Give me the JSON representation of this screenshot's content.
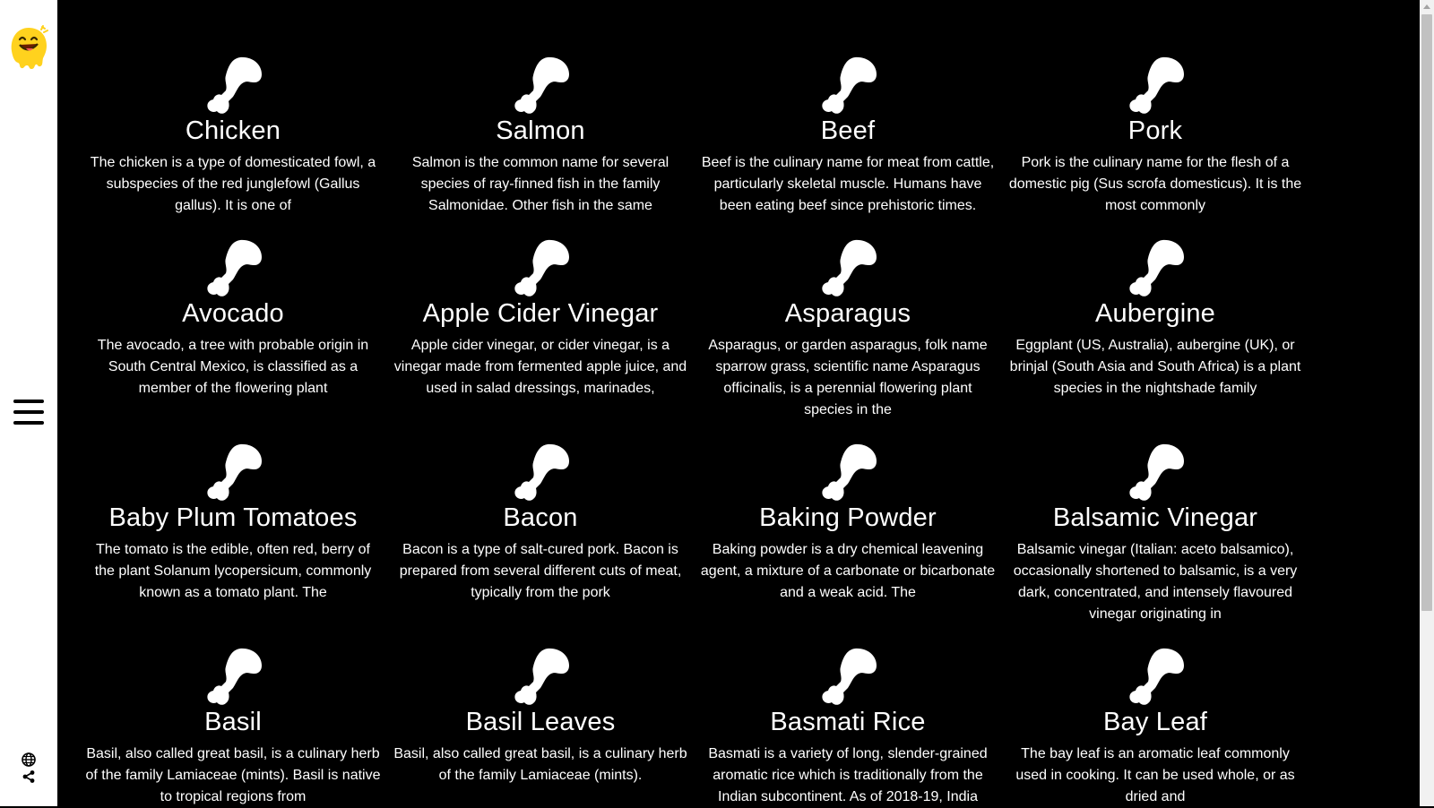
{
  "sidebar": {
    "logo_icon": "smiling-face-logo",
    "menu_icon": "hamburger-menu-icon",
    "language_icon": "globe-icon",
    "share_icon": "share-icon"
  },
  "cards": [
    {
      "title": "Chicken",
      "description": "The chicken is a type of domesticated fowl, a subspecies of the red junglefowl (Gallus gallus). It is one of",
      "icon": "drumstick-icon"
    },
    {
      "title": "Salmon",
      "description": "Salmon is the common name for several species of ray-finned fish in the family Salmonidae. Other fish in the same",
      "icon": "drumstick-icon"
    },
    {
      "title": "Beef",
      "description": "Beef is the culinary name for meat from cattle, particularly skeletal muscle. Humans have been eating beef since prehistoric times.",
      "icon": "drumstick-icon"
    },
    {
      "title": "Pork",
      "description": "Pork is the culinary name for the flesh of a domestic pig (Sus scrofa domesticus). It is the most commonly",
      "icon": "drumstick-icon"
    },
    {
      "title": "Avocado",
      "description": "The avocado, a tree with probable origin in South Central Mexico, is classified as a member of the flowering plant",
      "icon": "drumstick-icon"
    },
    {
      "title": "Apple Cider Vinegar",
      "description": "Apple cider vinegar, or cider vinegar, is a vinegar made from fermented apple juice, and used in salad dressings, marinades,",
      "icon": "drumstick-icon"
    },
    {
      "title": "Asparagus",
      "description": "Asparagus, or garden asparagus, folk name sparrow grass, scientific name Asparagus officinalis, is a perennial flowering plant species in the",
      "icon": "drumstick-icon"
    },
    {
      "title": "Aubergine",
      "description": "Eggplant (US, Australia), aubergine (UK), or brinjal (South Asia and South Africa) is a plant species in the nightshade family",
      "icon": "drumstick-icon"
    },
    {
      "title": "Baby Plum Tomatoes",
      "description": "The tomato is the edible, often red, berry of the plant Solanum lycopersicum, commonly known as a tomato plant. The",
      "icon": "drumstick-icon"
    },
    {
      "title": "Bacon",
      "description": "Bacon is a type of salt-cured pork. Bacon is prepared from several different cuts of meat, typically from the pork",
      "icon": "drumstick-icon"
    },
    {
      "title": "Baking Powder",
      "description": "Baking powder is a dry chemical leavening agent, a mixture of a carbonate or bicarbonate and a weak acid. The",
      "icon": "drumstick-icon"
    },
    {
      "title": "Balsamic Vinegar",
      "description": "Balsamic vinegar (Italian: aceto balsamico), occasionally shortened to balsamic, is a very dark, concentrated, and intensely flavoured vinegar originating in",
      "icon": "drumstick-icon"
    },
    {
      "title": "Basil",
      "description": "Basil, also called great basil, is a culinary herb of the family Lamiaceae (mints). Basil is native to tropical regions from",
      "icon": "drumstick-icon"
    },
    {
      "title": "Basil Leaves",
      "description": "Basil, also called great basil, is a culinary herb of the family Lamiaceae (mints).",
      "icon": "drumstick-icon"
    },
    {
      "title": "Basmati Rice",
      "description": "Basmati is a variety of long, slender-grained aromatic rice which is traditionally from the Indian subcontinent. As of 2018-19, India",
      "icon": "drumstick-icon"
    },
    {
      "title": "Bay Leaf",
      "description": "The bay leaf is an aromatic leaf commonly used in cooking. It can be used whole, or as dried and",
      "icon": "drumstick-icon"
    }
  ]
}
